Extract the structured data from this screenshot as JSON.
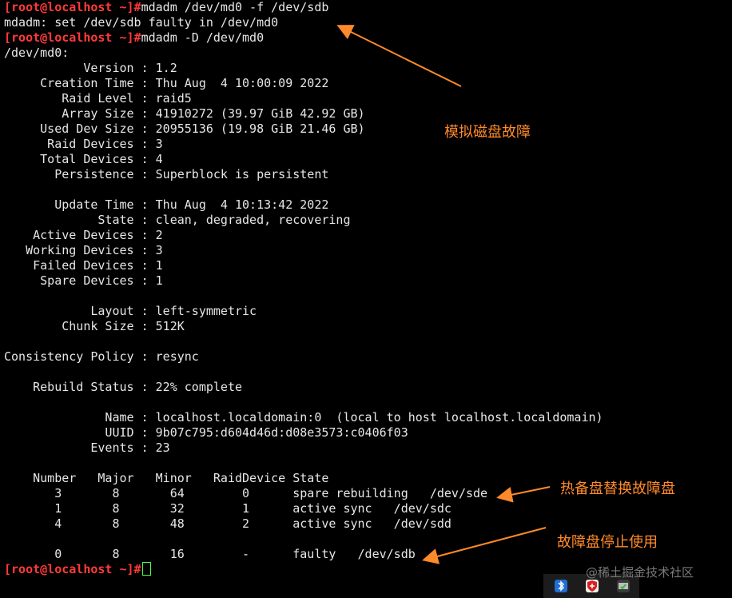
{
  "terminal": {
    "lines": [
      {
        "prompt": "[root@localhost ~]#",
        "text": "mdadm /dev/md0 -f /dev/sdb"
      },
      {
        "prompt": "",
        "text": "mdadm: set /dev/sdb faulty in /dev/md0"
      },
      {
        "prompt": "[root@localhost ~]#",
        "text": "mdadm -D /dev/md0"
      },
      {
        "prompt": "",
        "text": "/dev/md0:"
      },
      {
        "prompt": "",
        "text": "           Version : 1.2"
      },
      {
        "prompt": "",
        "text": "     Creation Time : Thu Aug  4 10:00:09 2022"
      },
      {
        "prompt": "",
        "text": "        Raid Level : raid5"
      },
      {
        "prompt": "",
        "text": "        Array Size : 41910272 (39.97 GiB 42.92 GB)"
      },
      {
        "prompt": "",
        "text": "     Used Dev Size : 20955136 (19.98 GiB 21.46 GB)"
      },
      {
        "prompt": "",
        "text": "      Raid Devices : 3"
      },
      {
        "prompt": "",
        "text": "     Total Devices : 4"
      },
      {
        "prompt": "",
        "text": "       Persistence : Superblock is persistent"
      },
      {
        "prompt": "",
        "text": ""
      },
      {
        "prompt": "",
        "text": "       Update Time : Thu Aug  4 10:13:42 2022"
      },
      {
        "prompt": "",
        "text": "             State : clean, degraded, recovering"
      },
      {
        "prompt": "",
        "text": "    Active Devices : 2"
      },
      {
        "prompt": "",
        "text": "   Working Devices : 3"
      },
      {
        "prompt": "",
        "text": "    Failed Devices : 1"
      },
      {
        "prompt": "",
        "text": "     Spare Devices : 1"
      },
      {
        "prompt": "",
        "text": ""
      },
      {
        "prompt": "",
        "text": "            Layout : left-symmetric"
      },
      {
        "prompt": "",
        "text": "        Chunk Size : 512K"
      },
      {
        "prompt": "",
        "text": ""
      },
      {
        "prompt": "",
        "text": "Consistency Policy : resync"
      },
      {
        "prompt": "",
        "text": ""
      },
      {
        "prompt": "",
        "text": "    Rebuild Status : 22% complete"
      },
      {
        "prompt": "",
        "text": ""
      },
      {
        "prompt": "",
        "text": "              Name : localhost.localdomain:0  (local to host localhost.localdomain)"
      },
      {
        "prompt": "",
        "text": "              UUID : 9b07c795:d604d46d:d08e3573:c0406f03"
      },
      {
        "prompt": "",
        "text": "            Events : 23"
      },
      {
        "prompt": "",
        "text": ""
      },
      {
        "prompt": "",
        "text": "    Number   Major   Minor   RaidDevice State"
      },
      {
        "prompt": "",
        "text": "       3       8       64        0      spare rebuilding   /dev/sde"
      },
      {
        "prompt": "",
        "text": "       1       8       32        1      active sync   /dev/sdc"
      },
      {
        "prompt": "",
        "text": "       4       8       48        2      active sync   /dev/sdd"
      },
      {
        "prompt": "",
        "text": ""
      },
      {
        "prompt": "",
        "text": "       0       8       16        -      faulty   /dev/sdb"
      },
      {
        "prompt": "[root@localhost ~]#",
        "text": "",
        "cursor": true
      }
    ]
  },
  "annotations": {
    "simulate_fault": "模拟磁盘故障",
    "hot_spare_replace": "热备盘替换故障盘",
    "faulty_disk_stopped": "故障盘停止使用",
    "color": "#ff8a2a"
  },
  "watermark": "@稀土掘金技术社区",
  "tray_icons": [
    "bluetooth-icon",
    "security-shield-icon",
    "network-icon"
  ]
}
